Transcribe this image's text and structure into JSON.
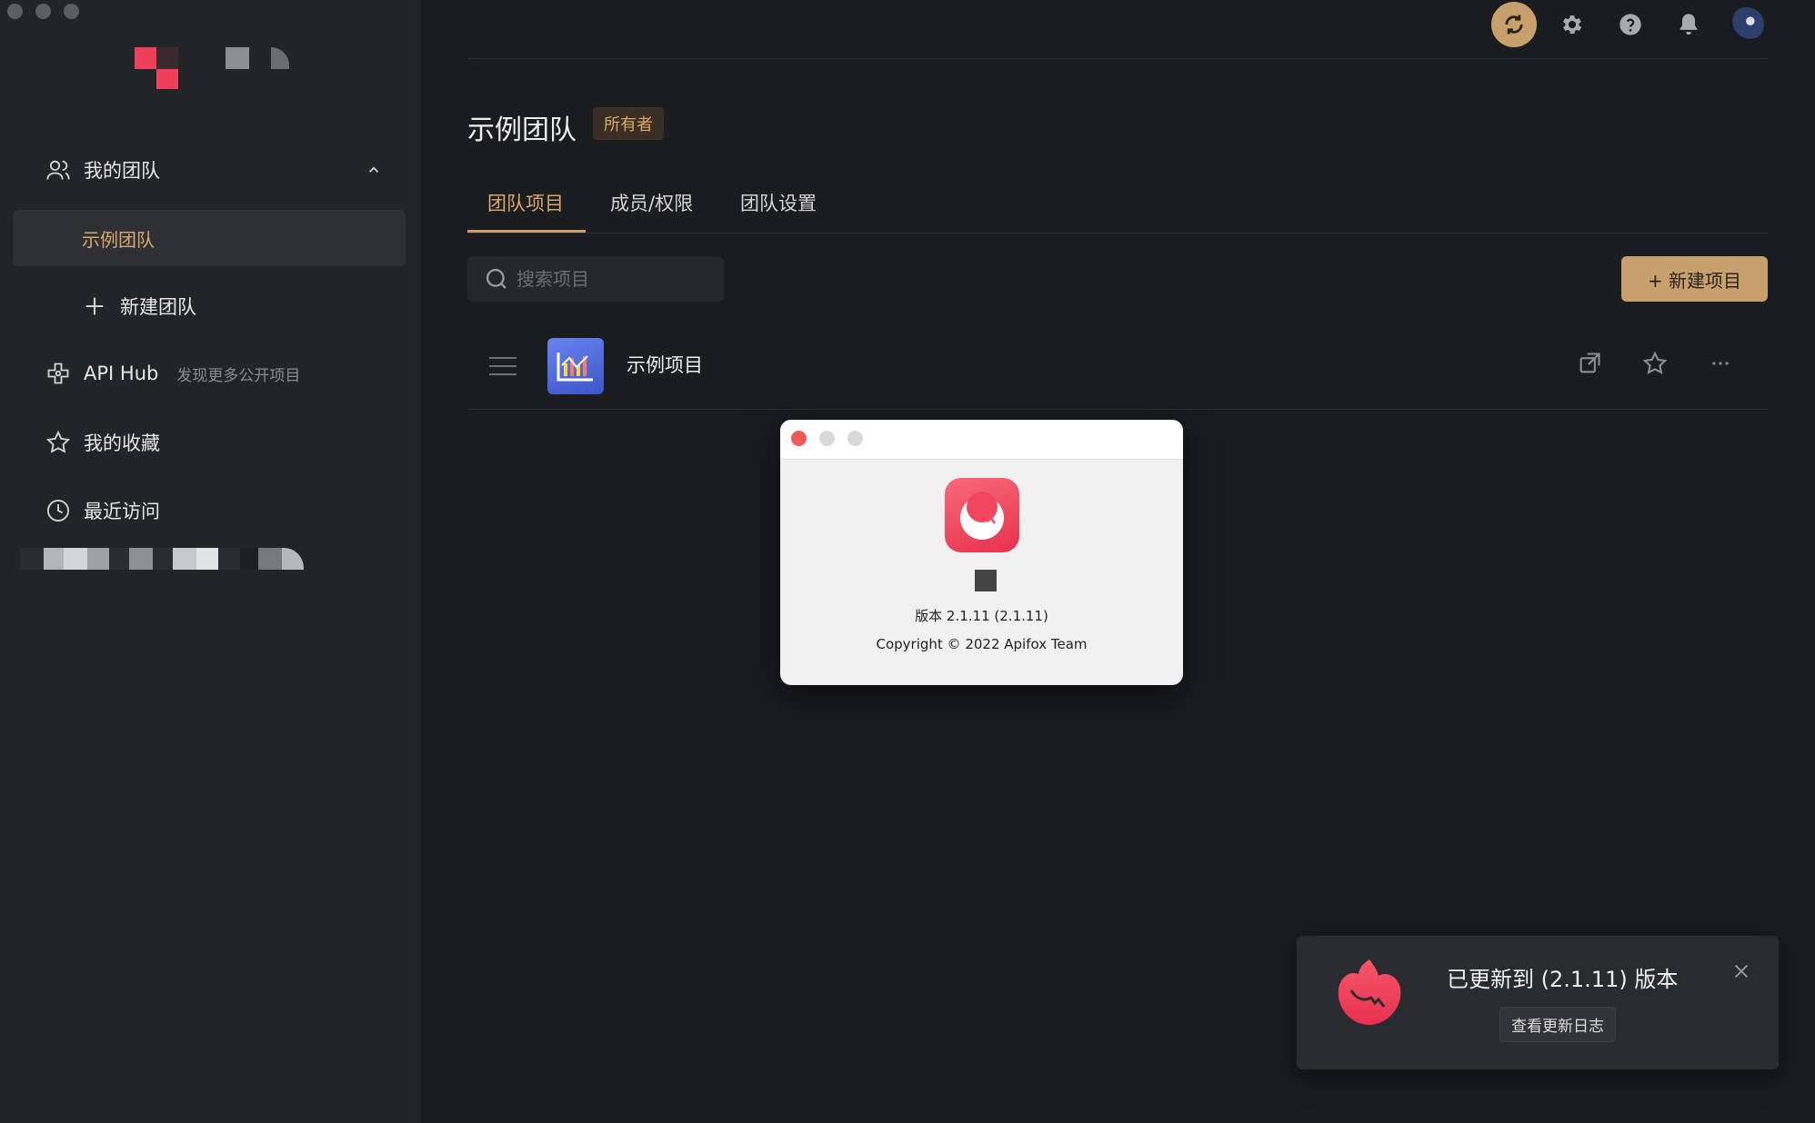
{
  "sidebar": {
    "my_team": "我的团队",
    "active_team": "示例团队",
    "new_team": "新建团队",
    "api_hub": "API Hub",
    "api_hub_sub": "发现更多公开项目",
    "favorites": "我的收藏",
    "recent": "最近访问"
  },
  "main": {
    "title": "示例团队",
    "owner_badge": "所有者",
    "tabs": [
      {
        "label": "团队项目"
      },
      {
        "label": "成员/权限"
      },
      {
        "label": "团队设置"
      }
    ],
    "search_placeholder": "搜索项目",
    "new_project": "+ 新建项目",
    "project": {
      "name": "示例项目"
    }
  },
  "about": {
    "version": "版本 2.1.11 (2.1.11)",
    "copyright": "Copyright © 2022 Apifox Team"
  },
  "toast": {
    "title": "已更新到 (2.1.11) 版本",
    "button": "查看更新日志"
  },
  "colors": {
    "accent": "#c7a06b",
    "accent_text": "#d9a86a",
    "bg": "#1b1c20",
    "sidebar": "#232428",
    "brand_red": "#e7314f"
  }
}
